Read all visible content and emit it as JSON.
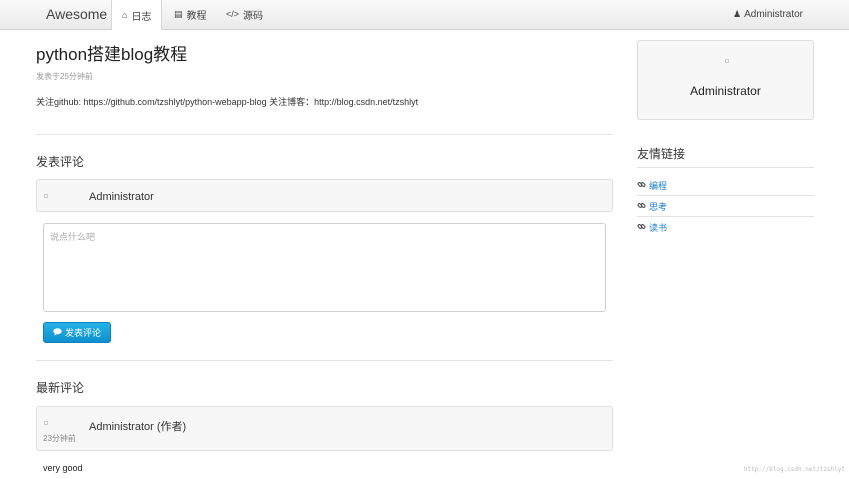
{
  "navbar": {
    "brand": "Awesome",
    "items": [
      {
        "label": "日志",
        "icon": "home-icon",
        "glyph": "⌂",
        "active": true
      },
      {
        "label": "教程",
        "icon": "book-icon",
        "glyph": "▤",
        "active": false
      },
      {
        "label": "源码",
        "icon": "code-icon",
        "glyph": "</>",
        "active": false
      }
    ],
    "user": {
      "label": "Administrator",
      "icon": "user-icon",
      "glyph": "♟"
    }
  },
  "post": {
    "title": "python搭建blog教程",
    "meta": "发表于25分钟前",
    "summary": "关注github: https://github.com/tzshlyt/python-webapp-blog 关注博客：http://blog.csdn.net/tzshlyt"
  },
  "comment_form": {
    "section_title": "发表评论",
    "user_name": "Administrator",
    "placeholder": "说点什么吧",
    "value": "",
    "submit_label": "发表评论",
    "submit_icon": "comment-icon"
  },
  "latest_comments": {
    "section_title": "最新评论",
    "items": [
      {
        "author": "Administrator (作者)",
        "time": "23分钟前",
        "text": "very good"
      }
    ]
  },
  "sidebar": {
    "user_name": "Administrator",
    "links_title": "友情链接",
    "links": [
      {
        "label": "编程",
        "icon": "link-icon"
      },
      {
        "label": "思考",
        "icon": "link-icon"
      },
      {
        "label": "读书",
        "icon": "link-icon"
      }
    ]
  },
  "watermark": "http://blog.csdn.net/tzshlyt",
  "colors": {
    "link": "#1a7fd1",
    "primary_button": "#1ba2dc",
    "panel_bg": "#f7f7f7"
  }
}
